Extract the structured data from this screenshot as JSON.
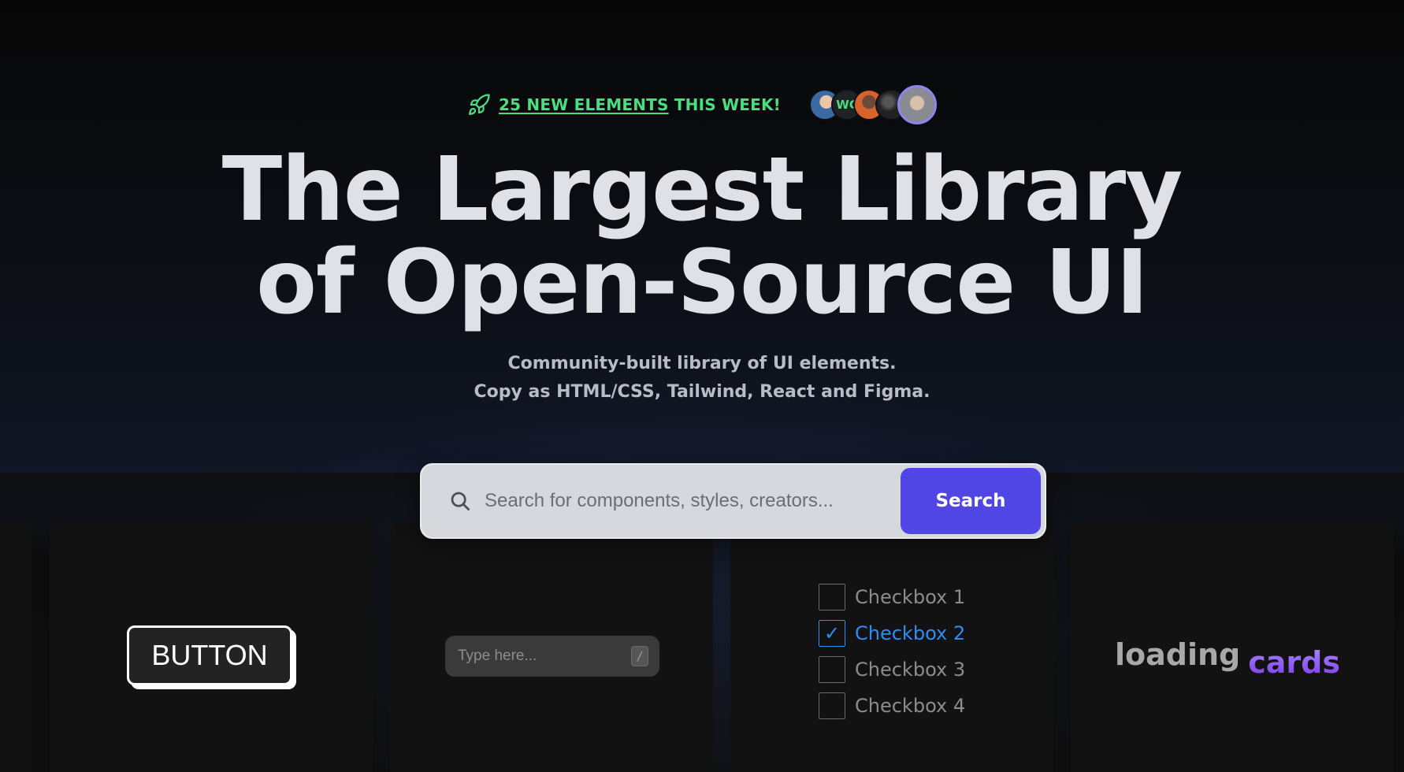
{
  "announcement": {
    "link_text": "25 NEW ELEMENTS",
    "suffix_text": "THIS WEEK!",
    "avatar_initials": "WC",
    "accent_color": "#4ade80"
  },
  "hero": {
    "title_line1": "The Largest Library",
    "title_line2": "of Open-Source UI",
    "subtitle_line1": "Community-built library of UI elements.",
    "subtitle_line2": "Copy as HTML/CSS, Tailwind, React and Figma."
  },
  "search": {
    "placeholder": "Search for components, styles, creators...",
    "button_label": "Search",
    "button_color": "#4f46e5"
  },
  "cards": {
    "button_demo_label": "BUTTON",
    "input_demo_placeholder": "Type here...",
    "input_demo_shortcut": "/",
    "checkboxes": [
      {
        "label": "Checkbox 1",
        "checked": false
      },
      {
        "label": "Checkbox 2",
        "checked": true
      },
      {
        "label": "Checkbox 3",
        "checked": false
      },
      {
        "label": "Checkbox 4",
        "checked": false
      }
    ],
    "checkbox_check_mark": "✓",
    "loading_label": "loading",
    "loading_word": "cards"
  },
  "icons": {
    "announcement": "rocket-icon",
    "search": "search-icon"
  }
}
